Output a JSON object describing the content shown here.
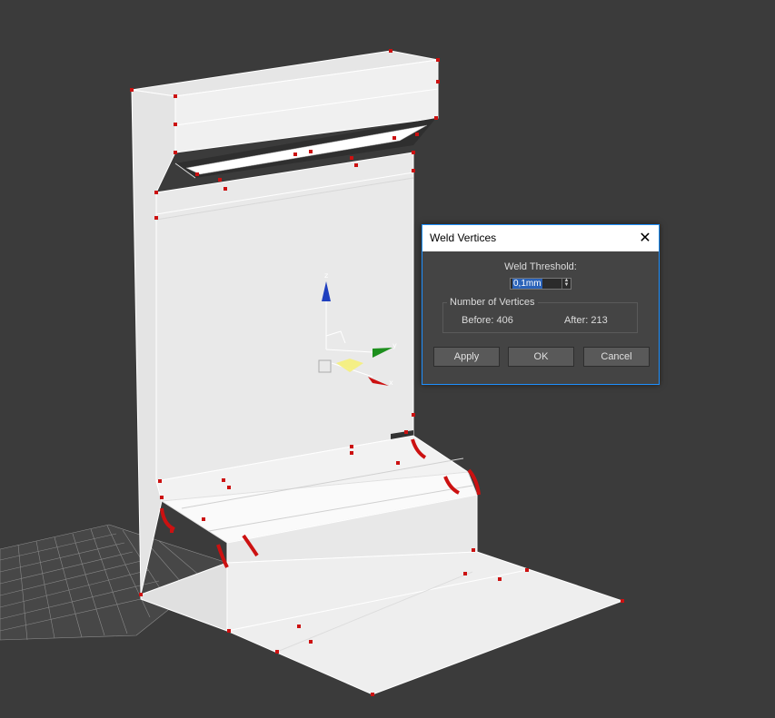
{
  "dialog": {
    "title": "Weld Vertices",
    "close_icon": "close-icon",
    "threshold_label": "Weld Threshold:",
    "threshold_value": "0,1mm",
    "vertices_group_label": "Number of Vertices",
    "before_label": "Before:",
    "before_value": "406",
    "after_label": "After:",
    "after_value": "213",
    "apply_label": "Apply",
    "ok_label": "OK",
    "cancel_label": "Cancel"
  },
  "viewport": {
    "background_color": "#3b3b3b",
    "mesh_color": "#f2f2f2",
    "vertex_color": "#cc1111",
    "gizmo_axes": [
      "z",
      "y",
      "x"
    ]
  }
}
